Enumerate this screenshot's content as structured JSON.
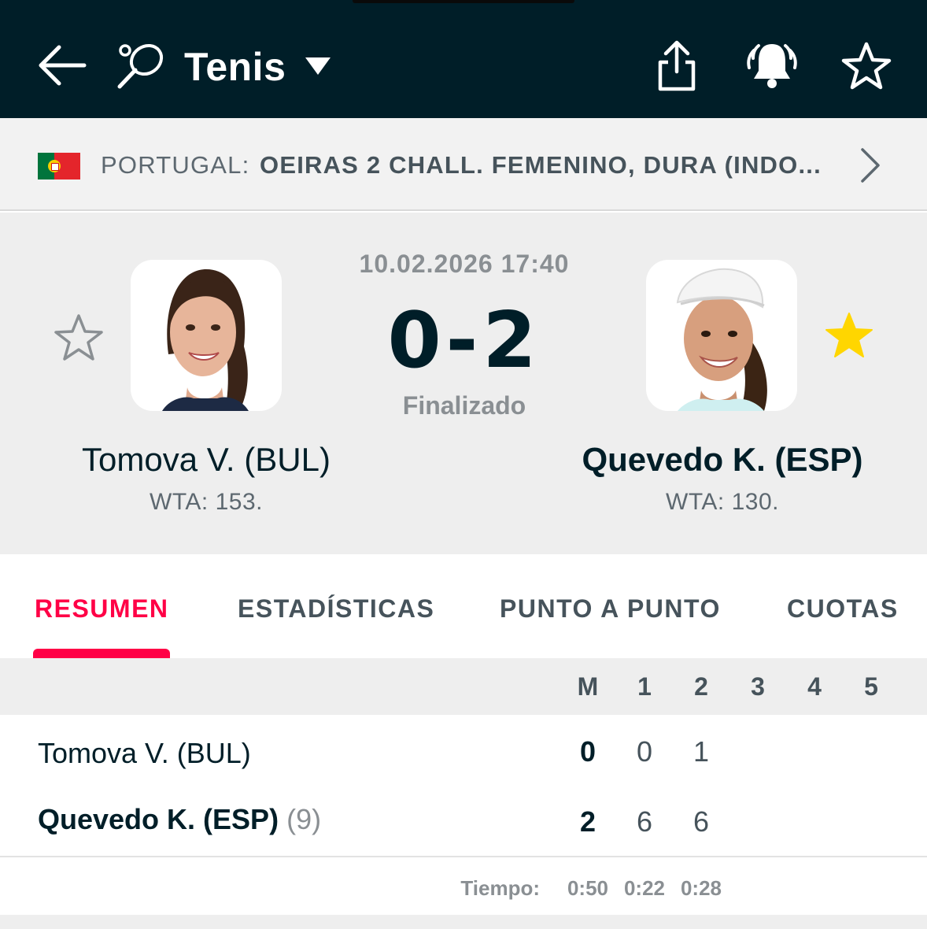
{
  "header": {
    "sport": "Tenis",
    "back_icon": "arrow-left-icon",
    "sport_icon": "tennis-racket-icon",
    "share_icon": "share-icon",
    "notify_icon": "bell-icon",
    "favorite_icon": "star-outline-icon"
  },
  "tournament": {
    "country": "PORTUGAL:",
    "name": "OEIRAS 2 CHALL. FEMENINO, DURA (INDO...",
    "flag": "portugal-flag"
  },
  "match": {
    "datetime": "10.02.2026 17:40",
    "score": "0-2",
    "status": "Finalizado",
    "home": {
      "name": "Tomova V. (BUL)",
      "rank": "WTA: 153.",
      "favorite": false
    },
    "away": {
      "name": "Quevedo K. (ESP)",
      "rank": "WTA: 130.",
      "favorite": true
    }
  },
  "tabs": [
    {
      "label": "RESUMEN",
      "active": true
    },
    {
      "label": "ESTADÍSTICAS",
      "active": false
    },
    {
      "label": "PUNTO A PUNTO",
      "active": false
    },
    {
      "label": "CUOTAS",
      "active": false
    }
  ],
  "score_table": {
    "columns": [
      "M",
      "1",
      "2",
      "3",
      "4",
      "5"
    ],
    "rows": [
      {
        "name": "Tomova V. (BUL)",
        "seed": "",
        "match": "0",
        "sets": [
          "0",
          "1"
        ]
      },
      {
        "name": "Quevedo K. (ESP)",
        "seed": "(9)",
        "match": "2",
        "sets": [
          "6",
          "6"
        ]
      }
    ],
    "time_label": "Tiempo:",
    "times": [
      "0:50",
      "0:22",
      "0:28"
    ]
  },
  "colors": {
    "header_bg": "#001e28",
    "accent": "#ff0046",
    "favorite_star": "#ffd600"
  }
}
